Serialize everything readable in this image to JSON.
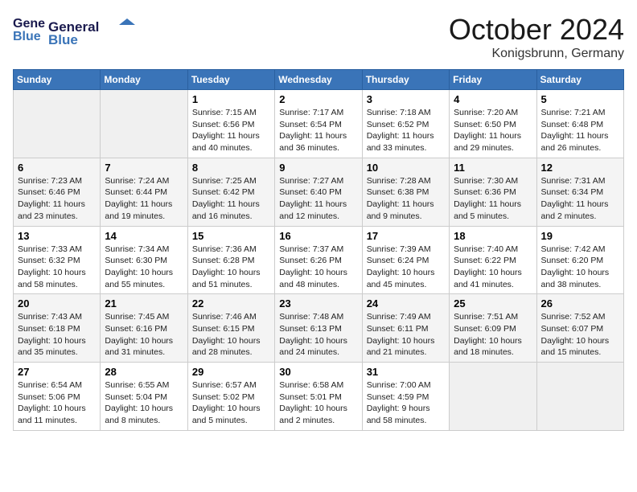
{
  "header": {
    "logo_general": "General",
    "logo_blue": "Blue",
    "month_title": "October 2024",
    "location": "Konigsbrunn, Germany"
  },
  "weekdays": [
    "Sunday",
    "Monday",
    "Tuesday",
    "Wednesday",
    "Thursday",
    "Friday",
    "Saturday"
  ],
  "weeks": [
    [
      {
        "day": "",
        "info": ""
      },
      {
        "day": "",
        "info": ""
      },
      {
        "day": "1",
        "info": "Sunrise: 7:15 AM\nSunset: 6:56 PM\nDaylight: 11 hours and 40 minutes."
      },
      {
        "day": "2",
        "info": "Sunrise: 7:17 AM\nSunset: 6:54 PM\nDaylight: 11 hours and 36 minutes."
      },
      {
        "day": "3",
        "info": "Sunrise: 7:18 AM\nSunset: 6:52 PM\nDaylight: 11 hours and 33 minutes."
      },
      {
        "day": "4",
        "info": "Sunrise: 7:20 AM\nSunset: 6:50 PM\nDaylight: 11 hours and 29 minutes."
      },
      {
        "day": "5",
        "info": "Sunrise: 7:21 AM\nSunset: 6:48 PM\nDaylight: 11 hours and 26 minutes."
      }
    ],
    [
      {
        "day": "6",
        "info": "Sunrise: 7:23 AM\nSunset: 6:46 PM\nDaylight: 11 hours and 23 minutes."
      },
      {
        "day": "7",
        "info": "Sunrise: 7:24 AM\nSunset: 6:44 PM\nDaylight: 11 hours and 19 minutes."
      },
      {
        "day": "8",
        "info": "Sunrise: 7:25 AM\nSunset: 6:42 PM\nDaylight: 11 hours and 16 minutes."
      },
      {
        "day": "9",
        "info": "Sunrise: 7:27 AM\nSunset: 6:40 PM\nDaylight: 11 hours and 12 minutes."
      },
      {
        "day": "10",
        "info": "Sunrise: 7:28 AM\nSunset: 6:38 PM\nDaylight: 11 hours and 9 minutes."
      },
      {
        "day": "11",
        "info": "Sunrise: 7:30 AM\nSunset: 6:36 PM\nDaylight: 11 hours and 5 minutes."
      },
      {
        "day": "12",
        "info": "Sunrise: 7:31 AM\nSunset: 6:34 PM\nDaylight: 11 hours and 2 minutes."
      }
    ],
    [
      {
        "day": "13",
        "info": "Sunrise: 7:33 AM\nSunset: 6:32 PM\nDaylight: 10 hours and 58 minutes."
      },
      {
        "day": "14",
        "info": "Sunrise: 7:34 AM\nSunset: 6:30 PM\nDaylight: 10 hours and 55 minutes."
      },
      {
        "day": "15",
        "info": "Sunrise: 7:36 AM\nSunset: 6:28 PM\nDaylight: 10 hours and 51 minutes."
      },
      {
        "day": "16",
        "info": "Sunrise: 7:37 AM\nSunset: 6:26 PM\nDaylight: 10 hours and 48 minutes."
      },
      {
        "day": "17",
        "info": "Sunrise: 7:39 AM\nSunset: 6:24 PM\nDaylight: 10 hours and 45 minutes."
      },
      {
        "day": "18",
        "info": "Sunrise: 7:40 AM\nSunset: 6:22 PM\nDaylight: 10 hours and 41 minutes."
      },
      {
        "day": "19",
        "info": "Sunrise: 7:42 AM\nSunset: 6:20 PM\nDaylight: 10 hours and 38 minutes."
      }
    ],
    [
      {
        "day": "20",
        "info": "Sunrise: 7:43 AM\nSunset: 6:18 PM\nDaylight: 10 hours and 35 minutes."
      },
      {
        "day": "21",
        "info": "Sunrise: 7:45 AM\nSunset: 6:16 PM\nDaylight: 10 hours and 31 minutes."
      },
      {
        "day": "22",
        "info": "Sunrise: 7:46 AM\nSunset: 6:15 PM\nDaylight: 10 hours and 28 minutes."
      },
      {
        "day": "23",
        "info": "Sunrise: 7:48 AM\nSunset: 6:13 PM\nDaylight: 10 hours and 24 minutes."
      },
      {
        "day": "24",
        "info": "Sunrise: 7:49 AM\nSunset: 6:11 PM\nDaylight: 10 hours and 21 minutes."
      },
      {
        "day": "25",
        "info": "Sunrise: 7:51 AM\nSunset: 6:09 PM\nDaylight: 10 hours and 18 minutes."
      },
      {
        "day": "26",
        "info": "Sunrise: 7:52 AM\nSunset: 6:07 PM\nDaylight: 10 hours and 15 minutes."
      }
    ],
    [
      {
        "day": "27",
        "info": "Sunrise: 6:54 AM\nSunset: 5:06 PM\nDaylight: 10 hours and 11 minutes."
      },
      {
        "day": "28",
        "info": "Sunrise: 6:55 AM\nSunset: 5:04 PM\nDaylight: 10 hours and 8 minutes."
      },
      {
        "day": "29",
        "info": "Sunrise: 6:57 AM\nSunset: 5:02 PM\nDaylight: 10 hours and 5 minutes."
      },
      {
        "day": "30",
        "info": "Sunrise: 6:58 AM\nSunset: 5:01 PM\nDaylight: 10 hours and 2 minutes."
      },
      {
        "day": "31",
        "info": "Sunrise: 7:00 AM\nSunset: 4:59 PM\nDaylight: 9 hours and 58 minutes."
      },
      {
        "day": "",
        "info": ""
      },
      {
        "day": "",
        "info": ""
      }
    ]
  ]
}
